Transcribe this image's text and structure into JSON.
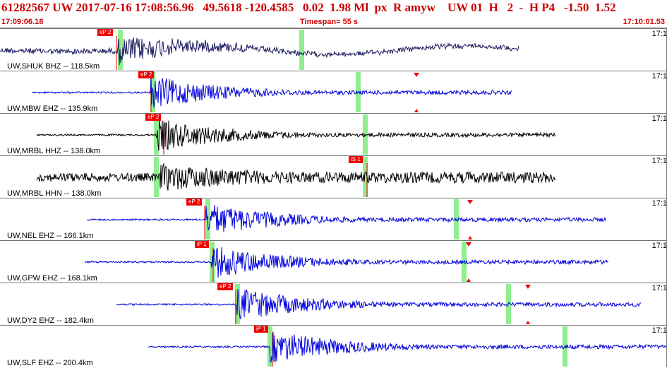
{
  "header": {
    "title": "61282567 UW 2017-07-16 17:08:56.96   49.5618 -120.4585   0.02  1.98 Ml  px  R amyw    UW 01  H   2  -  H P4   -1.50  1.52",
    "start_time": "17:09:06.18",
    "timespan": "Timespan=  55 s",
    "end_time": "17:10:01.53"
  },
  "colors": {
    "title": "#cc0000",
    "pick": "#ee0000",
    "window": "#90ee90",
    "trace_dark": "#1a1a5e",
    "trace_blue": "#0000dd",
    "trace_black": "#000000"
  },
  "panels": [
    {
      "label": "UW,SHUK BHZ -- 118.5km",
      "tick": "17:1",
      "pick": "eP 2",
      "color": "#1a1a5e",
      "style": "long"
    },
    {
      "label": "UW,MBW EHZ -- 135.9km",
      "tick": "17:1",
      "pick": "eP 2",
      "color": "#0000dd",
      "style": "short"
    },
    {
      "label": "UW,MRBL HHZ -- 138.0km",
      "tick": "17:1",
      "pick": "eP 2",
      "color": "#000000",
      "style": "short"
    },
    {
      "label": "UW,MRBL HHN -- 138.0km",
      "tick": "17:1",
      "pick": "iS 1",
      "color": "#000000",
      "style": "noisy"
    },
    {
      "label": "UW,NEL EHZ -- 166.1km",
      "tick": "17:1",
      "pick": "eP 2",
      "color": "#0000dd",
      "style": "short"
    },
    {
      "label": "UW,GPW EHZ -- 168.1km",
      "tick": "17:1",
      "pick": "iP 1",
      "color": "#0000dd",
      "style": "short"
    },
    {
      "label": "UW,DY2 EHZ -- 182.4km",
      "tick": "17:1",
      "pick": "eP 2",
      "color": "#0000dd",
      "style": "short"
    },
    {
      "label": "UW,SLF EHZ -- 200.4km",
      "tick": "17:1",
      "pick": "iP 1",
      "color": "#0000dd",
      "style": "short"
    }
  ]
}
